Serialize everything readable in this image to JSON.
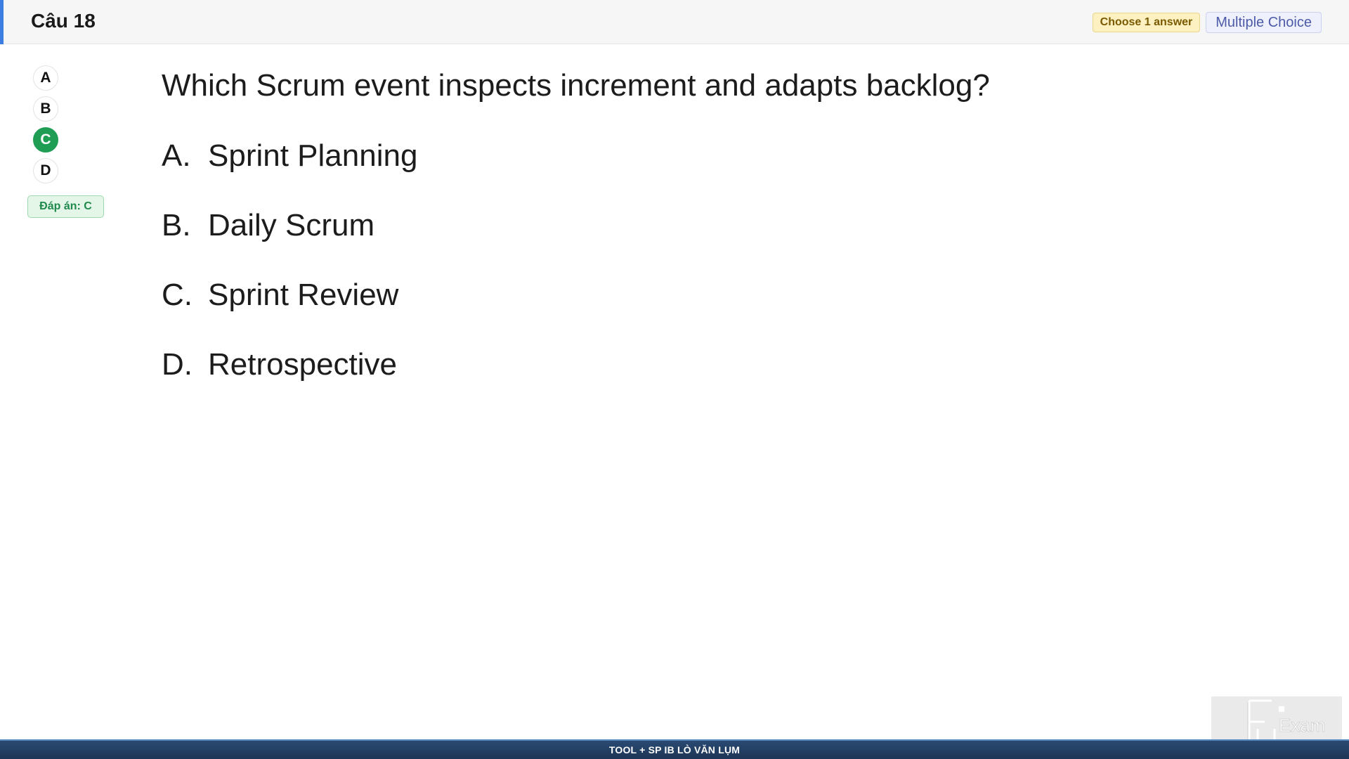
{
  "header": {
    "title": "Câu 18",
    "choose_badge": "Choose 1 answer",
    "type_badge": "Multiple Choice",
    "accent_color": "#3b7de0"
  },
  "sidebar": {
    "bubbles": [
      {
        "label": "A",
        "selected": false
      },
      {
        "label": "B",
        "selected": false
      },
      {
        "label": "C",
        "selected": true
      },
      {
        "label": "D",
        "selected": false
      }
    ],
    "answer_badge": "Đáp án: C",
    "selected_color": "#1f9d55"
  },
  "question": {
    "text": "Which Scrum event inspects increment and adapts backlog?",
    "options": [
      {
        "letter": "A.",
        "text": "Sprint Planning"
      },
      {
        "letter": "B.",
        "text": "Daily Scrum"
      },
      {
        "letter": "C.",
        "text": "Sprint Review"
      },
      {
        "letter": "D.",
        "text": "Retrospective"
      }
    ]
  },
  "footer": {
    "text": "TOOL + SP IB LÒ VĂN LỤM"
  },
  "watermark": {
    "text": "Exam",
    "icon": "fu-exam-logo"
  }
}
